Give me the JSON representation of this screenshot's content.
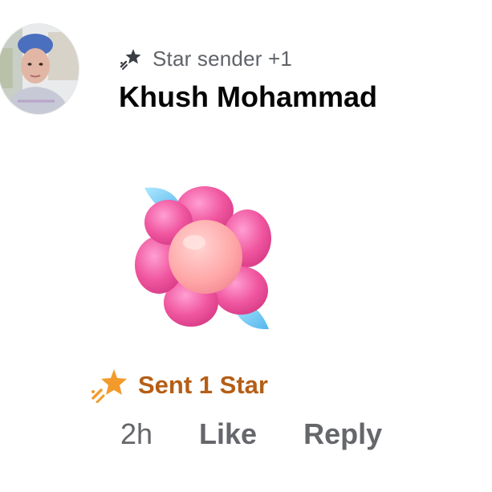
{
  "comment": {
    "author": {
      "name": "Khush Mohammad",
      "avatar_icon": "profile-photo"
    },
    "badge": {
      "icon": "star-sender-icon",
      "label": "Star sender +1"
    },
    "sticker": {
      "icon": "pink-flower-sticker"
    },
    "stars": {
      "icon": "star-icon",
      "label": "Sent 1 Star",
      "color": "#b55e16"
    },
    "actions": {
      "time": "2h",
      "like": "Like",
      "reply": "Reply"
    }
  }
}
